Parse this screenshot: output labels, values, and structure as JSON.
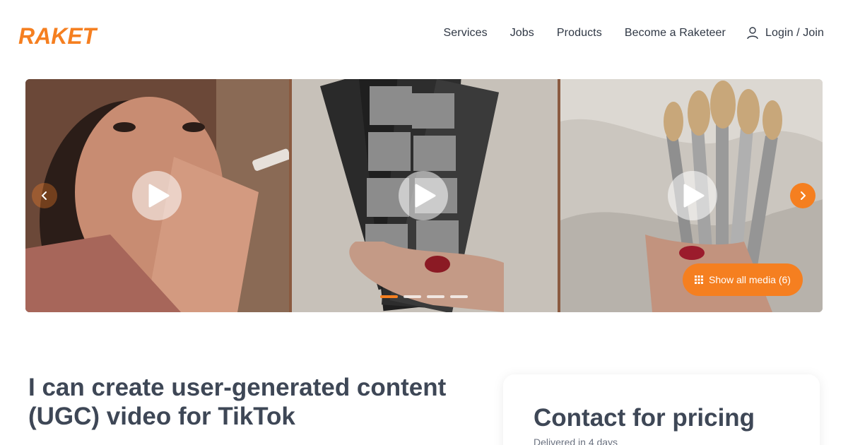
{
  "brand": {
    "name": "RAKET",
    "color": "#f57f20"
  },
  "nav": {
    "items": [
      {
        "label": "Services"
      },
      {
        "label": "Jobs"
      },
      {
        "label": "Products"
      },
      {
        "label": "Become a Raketeer"
      }
    ],
    "login_label": "Login / Join",
    "login_icon": "user-icon"
  },
  "gallery": {
    "slides": [
      {
        "icon": "play-icon"
      },
      {
        "icon": "play-icon"
      },
      {
        "icon": "play-icon"
      }
    ],
    "prev_icon": "chevron-left-icon",
    "next_icon": "chevron-right-icon",
    "show_all_label": "Show all media (6)",
    "show_all_icon": "grid-icon",
    "pagination": {
      "count": 4,
      "active_index": 0
    }
  },
  "service": {
    "title": "I can create user-generated content (UGC) video for TikTok"
  },
  "pricing": {
    "heading": "Contact for pricing",
    "delivery": "Delivered in 4 days"
  }
}
